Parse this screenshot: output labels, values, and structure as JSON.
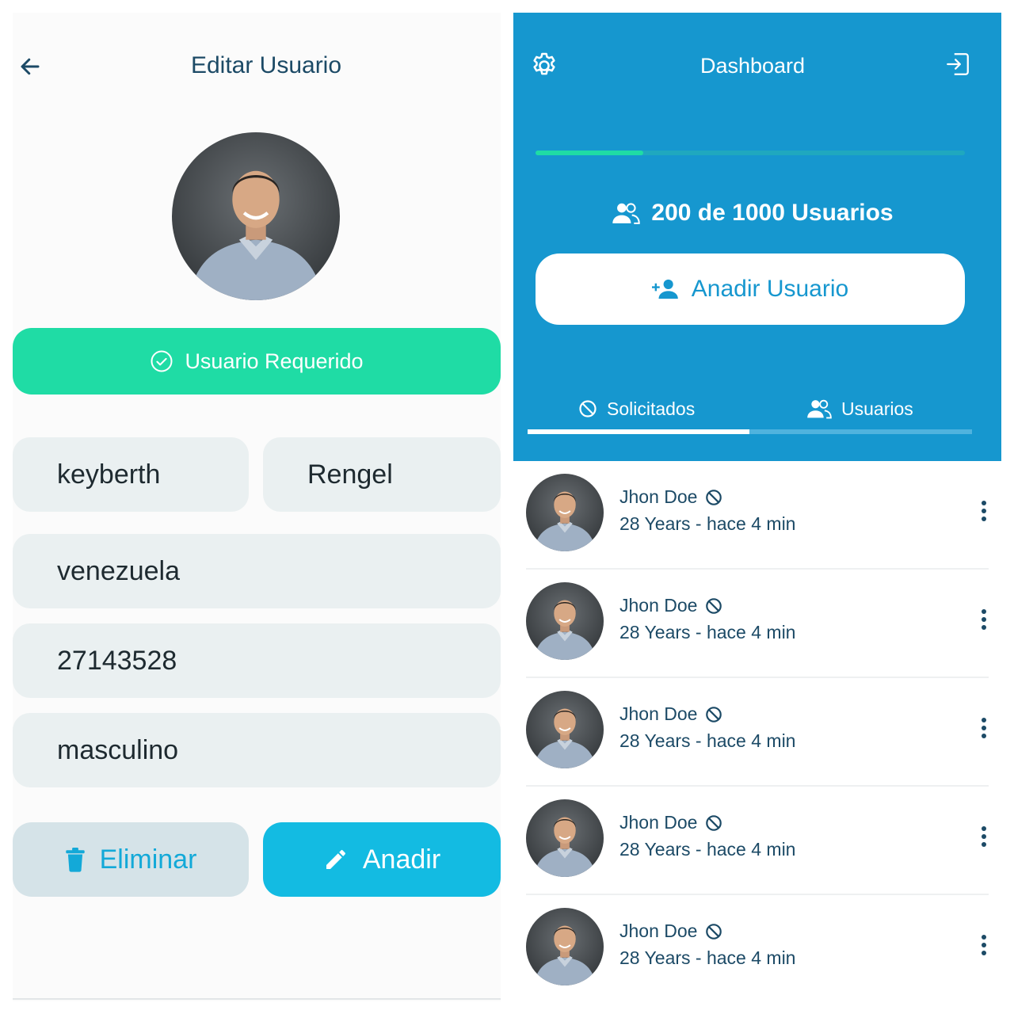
{
  "edit_screen": {
    "title": "Editar Usuario",
    "required_button": "Usuario Requerido",
    "fields": {
      "first_name": "keyberth",
      "last_name": "Rengel",
      "country": "venezuela",
      "id_number": "27143528",
      "gender": "masculino"
    },
    "delete_button": "Eliminar",
    "add_button": "Anadir"
  },
  "dashboard": {
    "title": "Dashboard",
    "progress": 0.25,
    "count_label": "200 de 1000 Usuarios",
    "add_user_button": "Anadir Usuario",
    "tabs": [
      {
        "label": "Solicitados",
        "active": true
      },
      {
        "label": "Usuarios",
        "active": false
      }
    ],
    "list": [
      {
        "name": "Jhon Doe",
        "subtitle": "28 Years - hace 4 min"
      },
      {
        "name": "Jhon Doe",
        "subtitle": "28 Years - hace 4 min"
      },
      {
        "name": "Jhon Doe",
        "subtitle": "28 Years - hace 4 min"
      },
      {
        "name": "Jhon Doe",
        "subtitle": "28 Years - hace 4 min"
      },
      {
        "name": "Jhon Doe",
        "subtitle": "28 Years - hace 4 min"
      }
    ]
  },
  "colors": {
    "primary_blue": "#1697cf",
    "accent_green": "#1fdca5",
    "button_cyan": "#13bbe2",
    "text_dark": "#1c4a66"
  },
  "icons": [
    "back-arrow-icon",
    "check-circle-icon",
    "trash-icon",
    "pencil-icon",
    "gear-icon",
    "logout-icon",
    "users-icon",
    "add-user-icon",
    "block-icon",
    "more-vertical-icon"
  ]
}
